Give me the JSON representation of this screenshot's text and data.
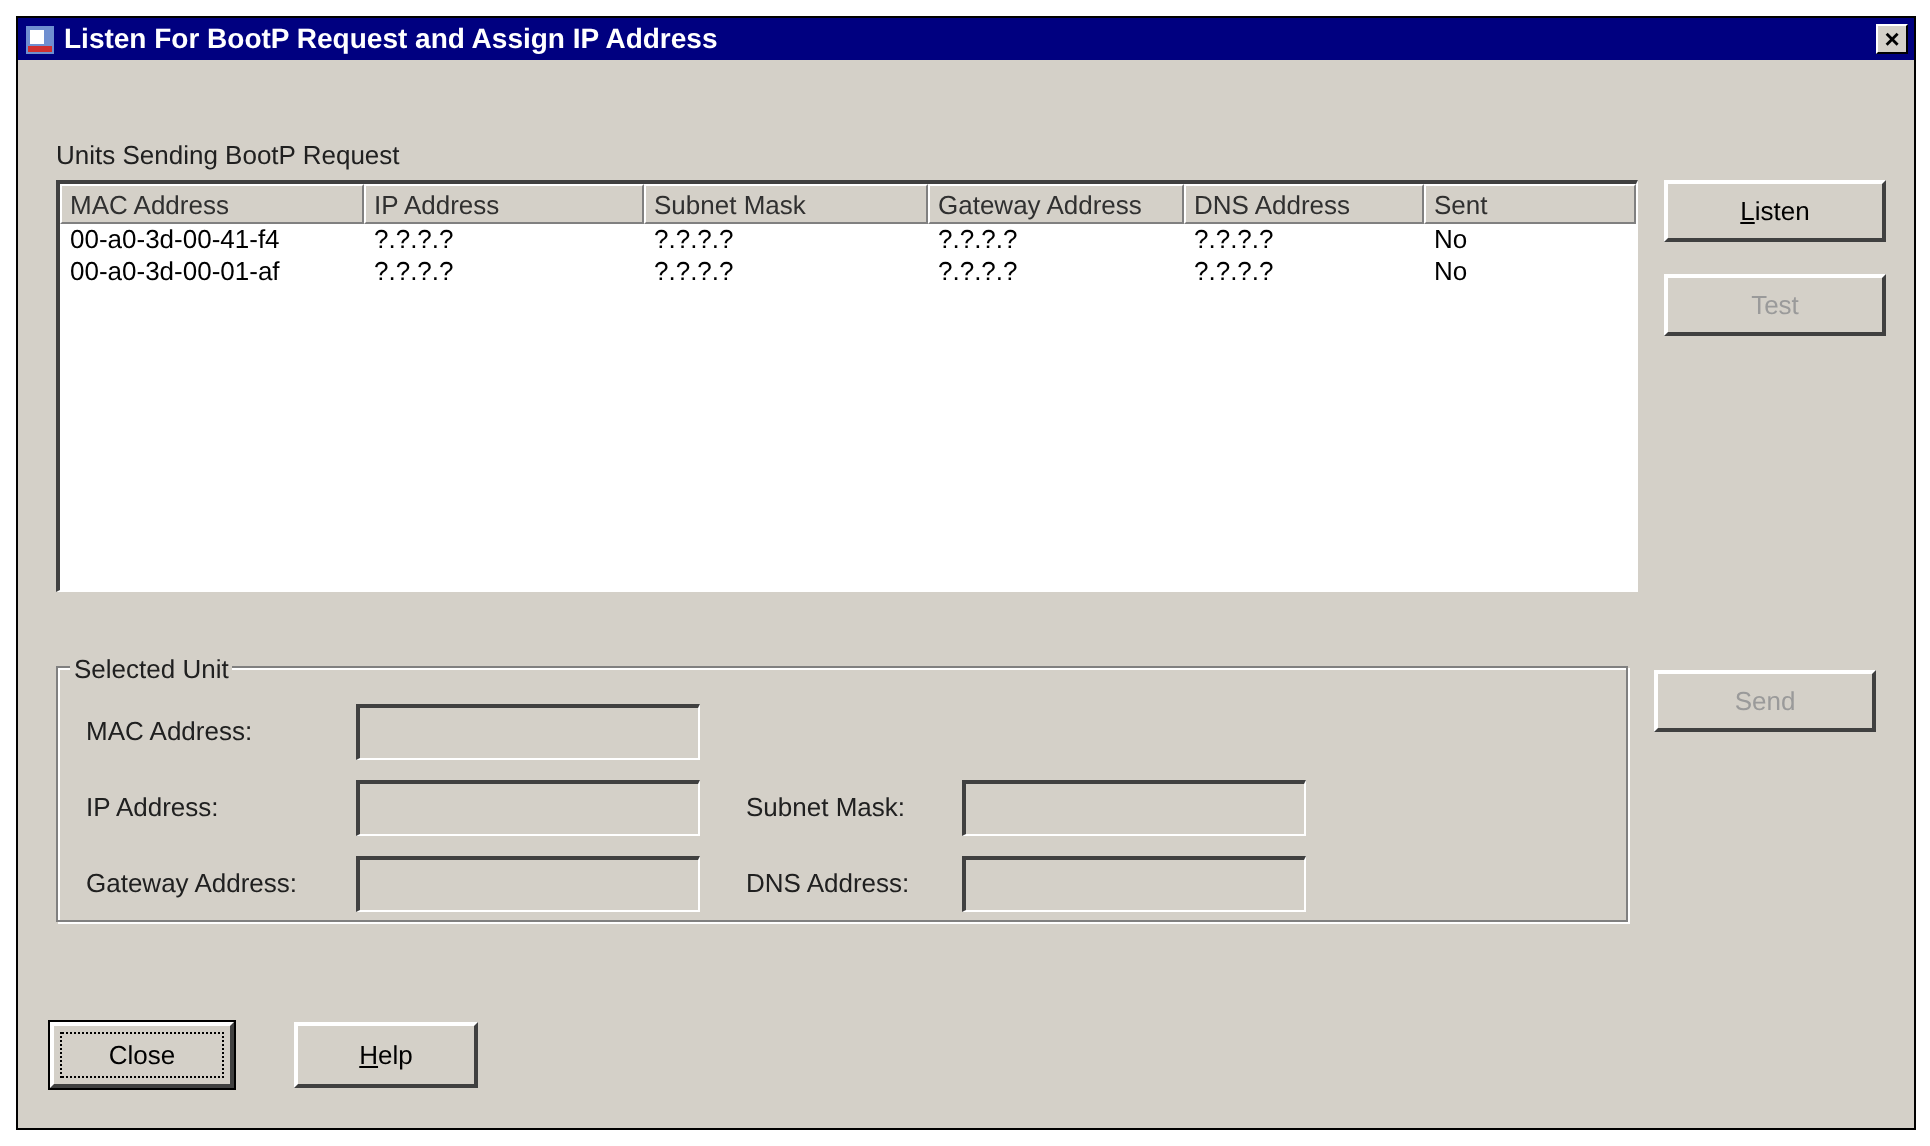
{
  "window": {
    "title": "Listen For BootP Request and Assign IP Address",
    "close": "×"
  },
  "units_list": {
    "label": "Units Sending BootP Request",
    "columns": [
      "MAC Address",
      "IP Address",
      "Subnet Mask",
      "Gateway Address",
      "DNS Address",
      "Sent"
    ],
    "rows": [
      [
        "00-a0-3d-00-41-f4",
        "?.?.?.?",
        "?.?.?.?",
        "?.?.?.?",
        "?.?.?.?",
        "No"
      ],
      [
        "00-a0-3d-00-01-af",
        "?.?.?.?",
        "?.?.?.?",
        "?.?.?.?",
        "?.?.?.?",
        "No"
      ]
    ]
  },
  "side_buttons": [
    {
      "label": "Listen",
      "disabled": false,
      "mnemonic_underlined": true
    },
    {
      "label": "Test",
      "disabled": true,
      "mnemonic_underlined": false
    }
  ],
  "selected_unit": {
    "title": "Selected Unit",
    "send": {
      "label": "Send",
      "disabled": true
    },
    "fields": [
      {
        "label": "MAC Address:",
        "disabled": true
      },
      {
        "label": "IP Address:",
        "disabled": true
      },
      {
        "label": "Subnet Mask:",
        "disabled": true
      },
      {
        "label": "Gateway Address:",
        "disabled": true
      },
      {
        "label": "DNS Address:",
        "disabled": true
      }
    ]
  },
  "bottom_buttons": [
    {
      "label": "Close",
      "focused": true,
      "mnemonic_underlined": false
    },
    {
      "label": "Help",
      "focused": false,
      "mnemonic_underlined": true
    }
  ]
}
